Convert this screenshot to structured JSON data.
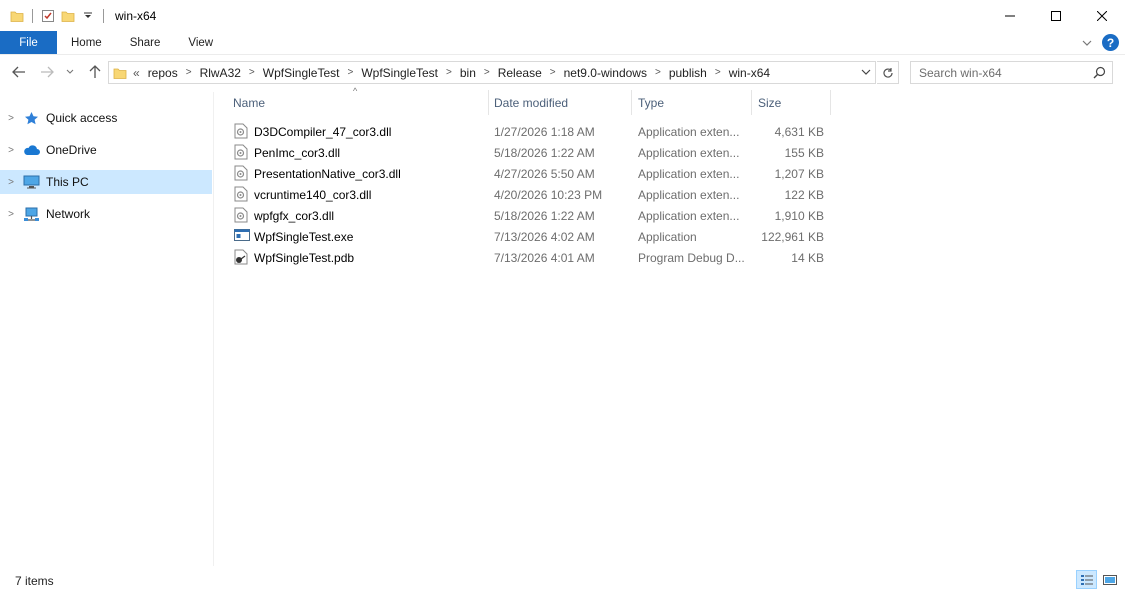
{
  "window": {
    "title": "win-x64",
    "controls": {
      "minimize_icon": "minimize-icon",
      "maximize_icon": "maximize-icon",
      "close_icon": "close-icon"
    }
  },
  "ribbon": {
    "tabs": [
      {
        "label": "File",
        "active": true
      },
      {
        "label": "Home"
      },
      {
        "label": "Share"
      },
      {
        "label": "View"
      }
    ],
    "accent": "#1a6cc4"
  },
  "address": {
    "overflow": "«",
    "crumbs": [
      "repos",
      "RlwA32",
      "WpfSingleTest",
      "WpfSingleTest",
      "bin",
      "Release",
      "net9.0-windows",
      "publish",
      "win-x64"
    ]
  },
  "search": {
    "placeholder": "Search win-x64"
  },
  "nav": {
    "items": [
      {
        "label": "Quick access",
        "icon": "star-icon"
      },
      {
        "label": "OneDrive",
        "icon": "cloud-icon"
      },
      {
        "label": "This PC",
        "icon": "computer-icon",
        "selected": true
      },
      {
        "label": "Network",
        "icon": "network-icon"
      }
    ]
  },
  "columns": {
    "name": "Name",
    "date": "Date modified",
    "type": "Type",
    "size": "Size"
  },
  "files": [
    {
      "name": "D3DCompiler_47_cor3.dll",
      "date": "1/27/2026 1:18 AM",
      "type": "Application exten...",
      "size": "4,631 KB",
      "icon": "dll-file-icon"
    },
    {
      "name": "PenImc_cor3.dll",
      "date": "5/18/2026 1:22 AM",
      "type": "Application exten...",
      "size": "155 KB",
      "icon": "dll-file-icon"
    },
    {
      "name": "PresentationNative_cor3.dll",
      "date": "4/27/2026 5:50 AM",
      "type": "Application exten...",
      "size": "1,207 KB",
      "icon": "dll-file-icon"
    },
    {
      "name": "vcruntime140_cor3.dll",
      "date": "4/20/2026 10:23 PM",
      "type": "Application exten...",
      "size": "122 KB",
      "icon": "dll-file-icon"
    },
    {
      "name": "wpfgfx_cor3.dll",
      "date": "5/18/2026 1:22 AM",
      "type": "Application exten...",
      "size": "1,910 KB",
      "icon": "dll-file-icon"
    },
    {
      "name": "WpfSingleTest.exe",
      "date": "7/13/2026 4:02 AM",
      "type": "Application",
      "size": "122,961 KB",
      "icon": "exe-file-icon"
    },
    {
      "name": "WpfSingleTest.pdb",
      "date": "7/13/2026 4:01 AM",
      "type": "Program Debug D...",
      "size": "14 KB",
      "icon": "pdb-file-icon"
    }
  ],
  "status": {
    "item_count": "7 items"
  }
}
